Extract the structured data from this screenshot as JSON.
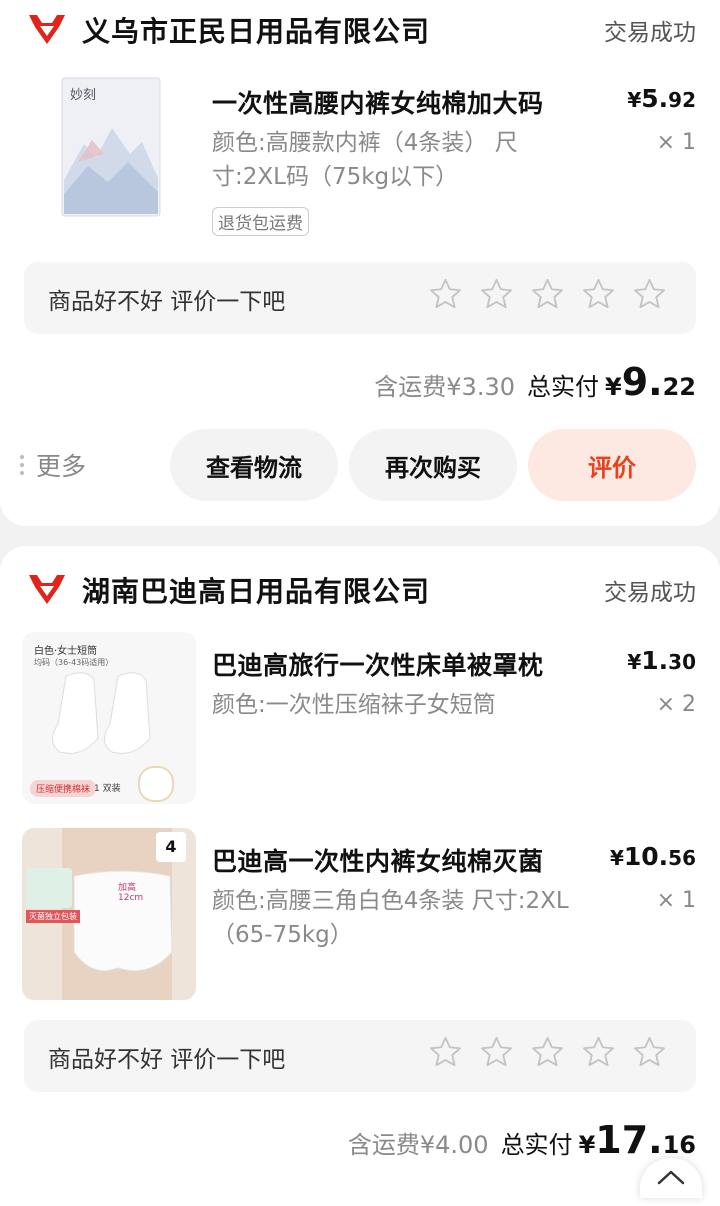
{
  "orders": [
    {
      "shop_name": "义乌市正民日用品有限公司",
      "status": "交易成功",
      "items": [
        {
          "title": "一次性高腰内裤女纯棉加大码",
          "spec": "颜色:高腰款内裤（4条装） 尺寸:2XL码（75kg以下）",
          "price_symbol": "¥",
          "price_int": "5.",
          "price_dec": "92",
          "qty": "× 1",
          "tag": "退货包运费",
          "thumb_brand": "妙刻"
        }
      ],
      "review_prompt": "商品好不好 评价一下吧",
      "shipping": "含运费¥3.30",
      "total_label": "总实付",
      "total_symbol": "¥",
      "total_int": "9.",
      "total_dec": "22",
      "more_label": "更多",
      "buttons": {
        "logistics": "查看物流",
        "rebuy": "再次购买",
        "review": "评价"
      }
    },
    {
      "shop_name": "湖南巴迪高日用品有限公司",
      "status": "交易成功",
      "items": [
        {
          "title": "巴迪高旅行一次性床单被罩枕",
          "spec": "颜色:一次性压缩袜子女短筒",
          "price_symbol": "¥",
          "price_int": "1.",
          "price_dec": "30",
          "qty": "× 2",
          "thumb_label_top": "白色·女士短筒",
          "thumb_label_sub": "均码（36-43码适用）",
          "thumb_badge": "压缩便携棉袜",
          "thumb_count": "1 双装"
        },
        {
          "title": "巴迪高一次性内裤女纯棉灭菌",
          "spec": "颜色:高腰三角白色4条装 尺寸:2XL（65-75kg）",
          "price_symbol": "¥",
          "price_int": "10.",
          "price_dec": "56",
          "qty": "× 1",
          "thumb_count": "4",
          "thumb_band": "加高 12cm",
          "thumb_badge": "灭菌独立包装"
        }
      ],
      "review_prompt": "商品好不好 评价一下吧",
      "shipping": "含运费¥4.00",
      "total_label": "总实付",
      "total_symbol": "¥",
      "total_int": "17.",
      "total_dec": "16"
    }
  ],
  "colors": {
    "accent": "#e8411e",
    "accent_bg": "#fde8e2",
    "logo_red": "#e2231a"
  },
  "icons": [
    "shop-bull-logo-icon",
    "star-outline-icon",
    "more-dots-icon",
    "chevron-up-icon"
  ]
}
